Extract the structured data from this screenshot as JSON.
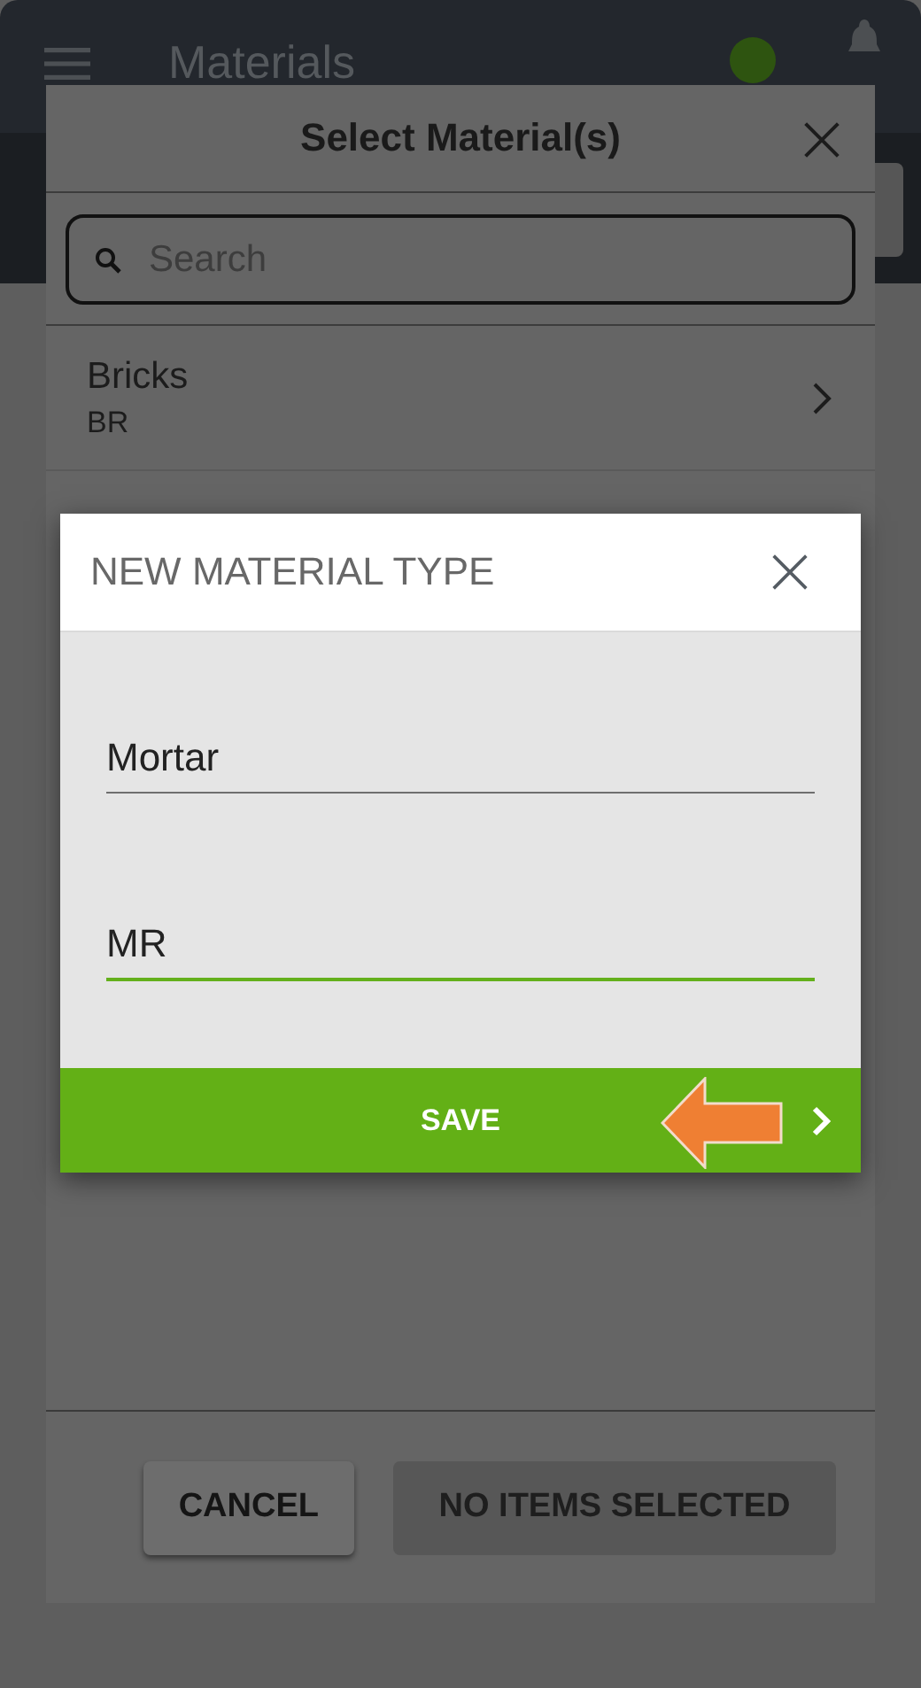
{
  "app_bar": {
    "title": "Materials"
  },
  "select_dialog": {
    "title": "Select Material(s)",
    "search": {
      "placeholder": "Search"
    },
    "items": [
      {
        "name": "Bricks",
        "code": "BR"
      }
    ],
    "buttons": [
      {
        "label": "CANCEL",
        "disabled": false
      },
      {
        "label": "NO ITEMS SELECTED",
        "disabled": true
      }
    ]
  },
  "new_type_dialog": {
    "title": "NEW MATERIAL TYPE",
    "fields": [
      {
        "value": "Mortar",
        "focused": false
      },
      {
        "value": "MR",
        "focused": true
      }
    ],
    "save_label": "SAVE"
  }
}
